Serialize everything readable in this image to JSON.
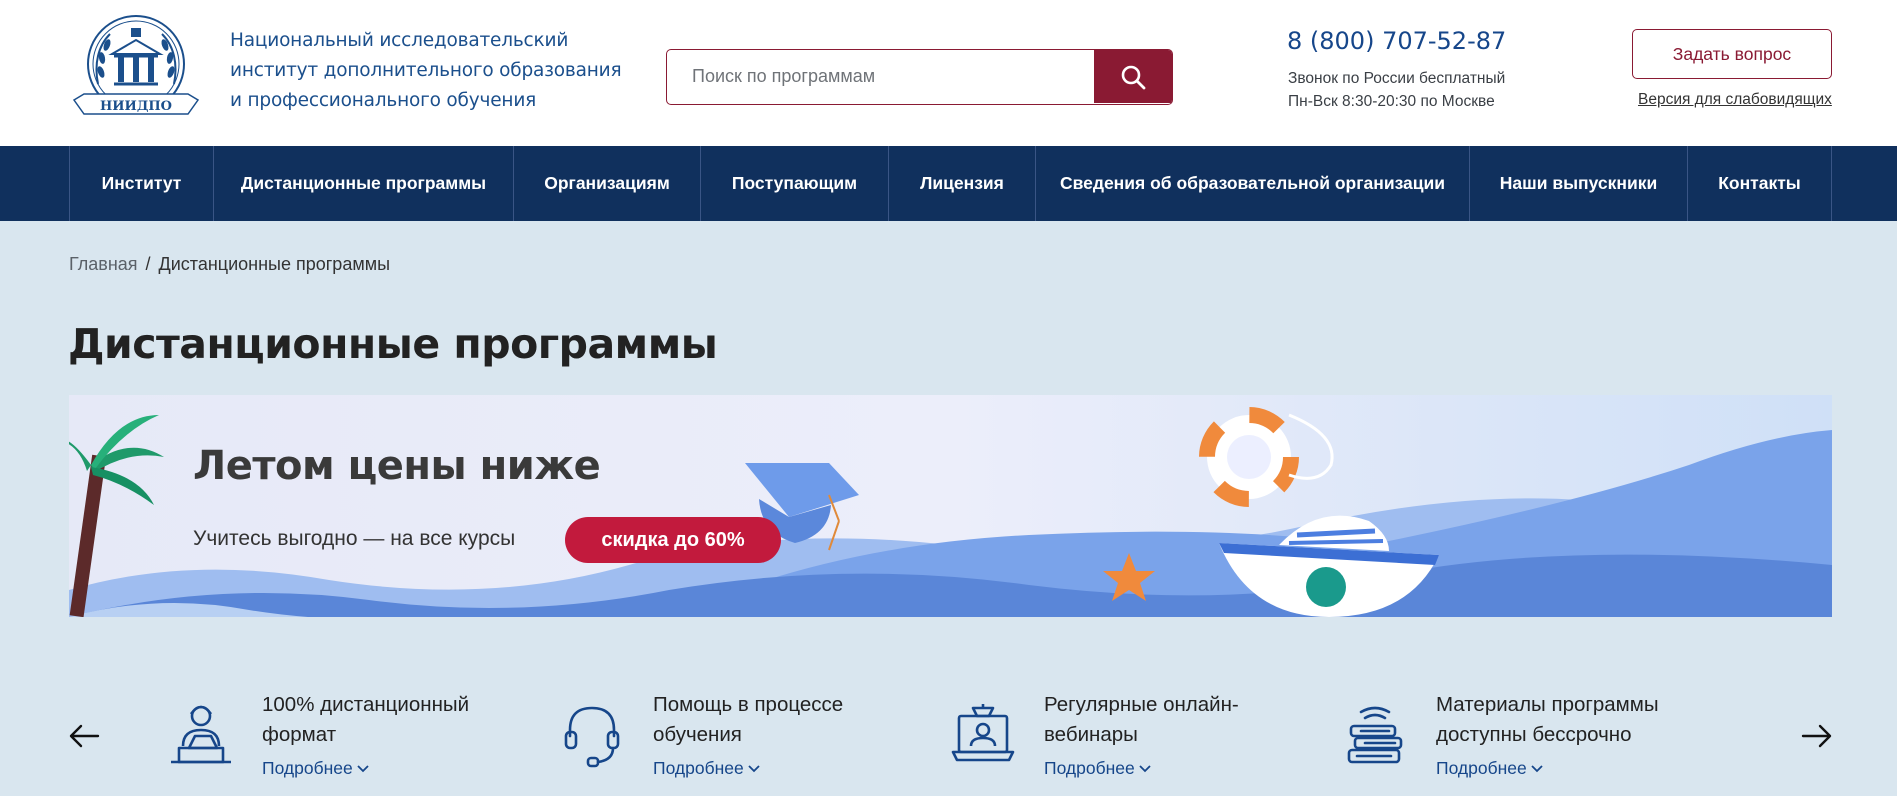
{
  "header": {
    "logo_text": "НИИДПО",
    "institute_name": [
      "Национальный исследовательский",
      "институт дополнительного образования",
      "и профессионального обучения"
    ],
    "search": {
      "placeholder": "Поиск по программам",
      "icon": "search-icon"
    },
    "phone": "8 (800) 707-52-87",
    "phone_note": [
      "Звонок по России бесплатный",
      "Пн-Вск 8:30-20:30 по Москве"
    ],
    "ask_button": "Задать вопрос",
    "low_vision_link": "Версия для слабовидящих"
  },
  "nav": {
    "items": [
      {
        "label": "Институт"
      },
      {
        "label": "Дистанционные программы"
      },
      {
        "label": "Организациям"
      },
      {
        "label": "Поступающим"
      },
      {
        "label": "Лицензия"
      },
      {
        "label": "Сведения об образовательной организации"
      },
      {
        "label": "Наши выпускники"
      },
      {
        "label": "Контакты"
      }
    ]
  },
  "breadcrumb": {
    "home": "Главная",
    "separator": "/",
    "current": "Дистанционные программы"
  },
  "page_title": "Дистанционные программы",
  "banner": {
    "title": "Летом цены ниже",
    "subtitle": "Учитесь выгодно — на все курсы",
    "badge": "скидка до 60%"
  },
  "features": {
    "items": [
      {
        "icon": "remote-learner-icon",
        "lines": [
          "100% дистанционный",
          "формат"
        ],
        "more": "Подробнее"
      },
      {
        "icon": "headset-icon",
        "lines": [
          "Помощь в процессе",
          "обучения"
        ],
        "more": "Подробнее"
      },
      {
        "icon": "webinar-icon",
        "lines": [
          "Регулярные онлайн-",
          "вебинары"
        ],
        "more": "Подробнее"
      },
      {
        "icon": "materials-icon",
        "lines": [
          "Материалы программы",
          "доступны бессрочно"
        ],
        "more": "Подробнее"
      }
    ]
  },
  "colors": {
    "nav_bg": "#10305d",
    "accent": "#8a1a33",
    "link": "#16468a",
    "page_bg": "#d9e6ef",
    "badge": "#c21a3d"
  }
}
